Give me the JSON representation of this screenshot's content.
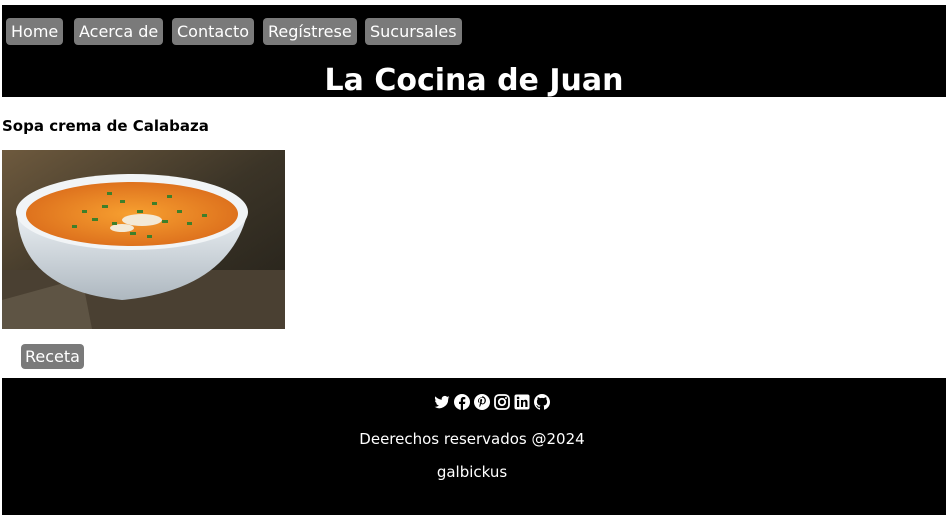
{
  "nav": {
    "items": [
      {
        "label": "Home"
      },
      {
        "label": "Acerca de"
      },
      {
        "label": "Contacto"
      },
      {
        "label": "Regístrese"
      },
      {
        "label": "Sucursales"
      }
    ]
  },
  "header": {
    "title": "La Cocina de Juan"
  },
  "recipe": {
    "title": "Sopa crema de Calabaza",
    "button_label": "Receta",
    "image_subject": "bowl of pumpkin cream soup"
  },
  "footer": {
    "social_icons": [
      "twitter-icon",
      "facebook-icon",
      "pinterest-icon",
      "instagram-icon",
      "linkedin-icon",
      "github-icon"
    ],
    "copyright": "Deerechos reservados @2024",
    "author": "galbickus"
  },
  "colors": {
    "bar_background": "#000000",
    "button_background": "#7a7a7a",
    "text_on_dark": "#ffffff"
  }
}
